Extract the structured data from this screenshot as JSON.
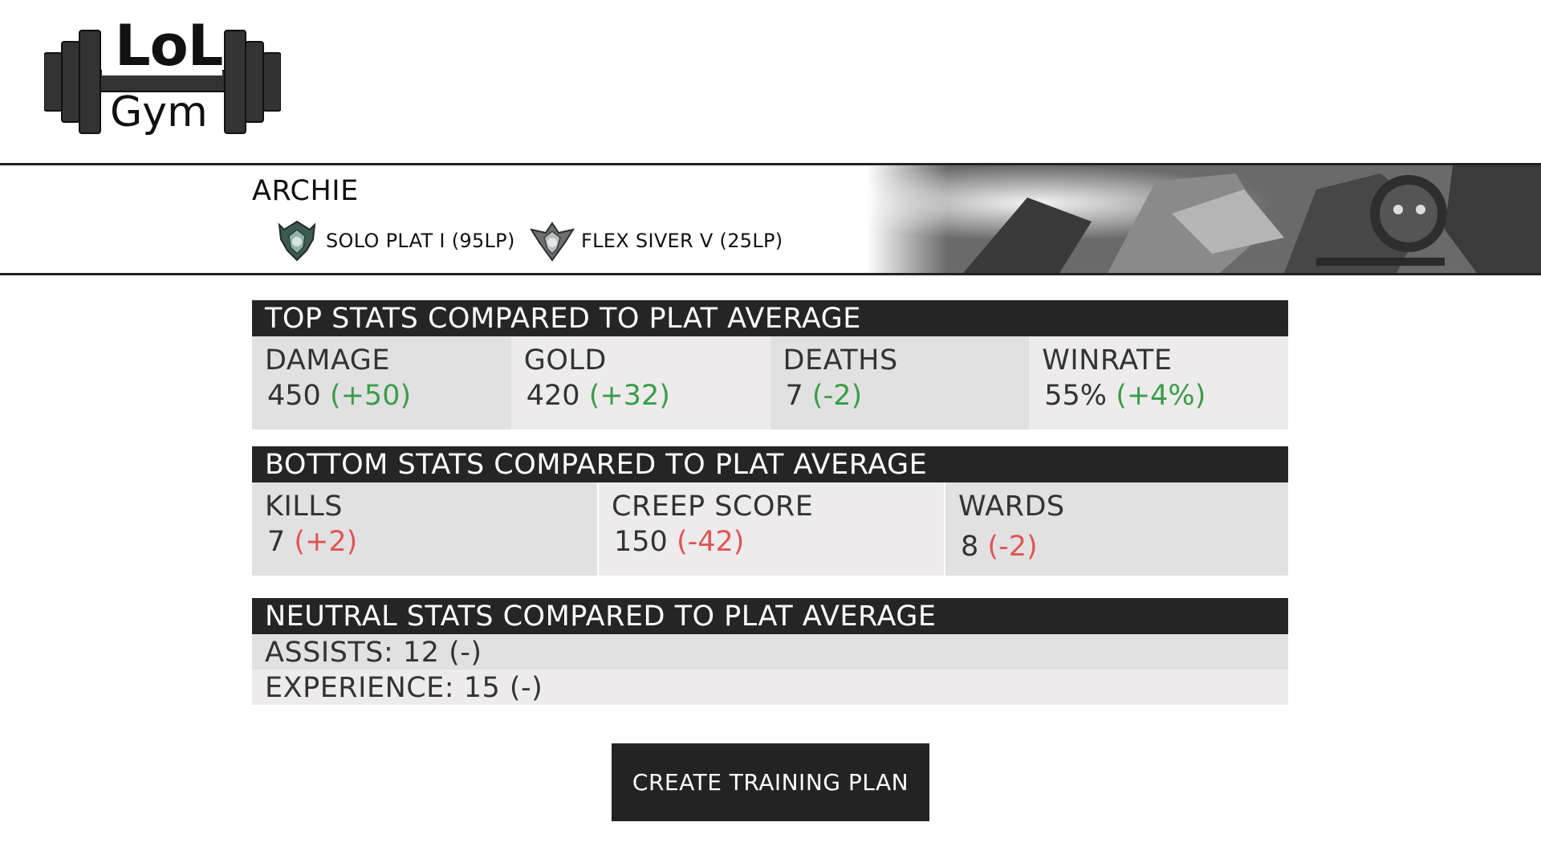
{
  "logo": {
    "top_text": "LoL",
    "bottom_text": "Gym"
  },
  "profile": {
    "name": "ARCHIE",
    "ranks": [
      {
        "icon": "platinum-emblem-icon",
        "label": "SOLO PLAT I (95LP)"
      },
      {
        "icon": "silver-emblem-icon",
        "label": "FLEX SIVER V (25LP)"
      }
    ]
  },
  "top_stats": {
    "title": "TOP STATS COMPARED TO PLAT AVERAGE",
    "items": [
      {
        "label": "DAMAGE",
        "value": "450",
        "delta": "(+50)",
        "status": "good"
      },
      {
        "label": "GOLD",
        "value": "420",
        "delta": "(+32)",
        "status": "good"
      },
      {
        "label": "DEATHS",
        "value": "7",
        "delta": "(-2)",
        "status": "good"
      },
      {
        "label": "WINRATE",
        "value": "55%",
        "delta": "(+4%)",
        "status": "good"
      }
    ]
  },
  "bottom_stats": {
    "title": "BOTTOM STATS COMPARED TO PLAT AVERAGE",
    "items": [
      {
        "label": "KILLS",
        "value": "7",
        "delta": "(+2)",
        "status": "bad"
      },
      {
        "label": "CREEP SCORE",
        "value": "150",
        "delta": "(-42)",
        "status": "bad"
      },
      {
        "label": "WARDS",
        "value": "8",
        "delta": "(-2)",
        "status": "bad"
      }
    ]
  },
  "neutral_stats": {
    "title": "NEUTRAL STATS COMPARED TO PLAT AVERAGE",
    "rows": [
      "ASSISTS: 12 (-)",
      "EXPERIENCE: 15 (-)"
    ]
  },
  "actions": {
    "create_plan_label": "CREATE TRAINING PLAN"
  },
  "colors": {
    "good": "#3a9d4a",
    "bad": "#e05555",
    "header_bg": "#252525",
    "cell_bg_a": "#e2e1e1",
    "cell_bg_b": "#edebeb"
  }
}
